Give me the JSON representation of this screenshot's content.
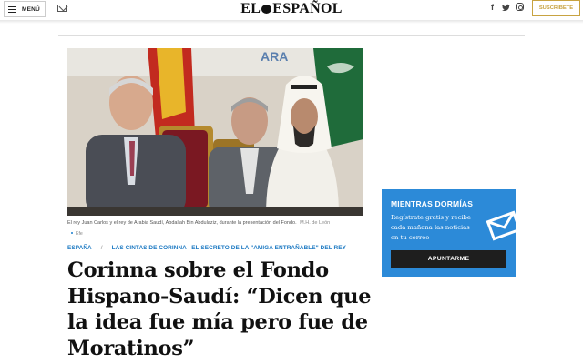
{
  "header": {
    "menu_label": "MENÚ",
    "logo_left": "EL",
    "logo_right": "ESPAÑOL",
    "subscribe_label": "SUSCRÍBETE",
    "social": [
      "f",
      "twitter",
      "instagram"
    ]
  },
  "photo": {
    "sign_text": "ARA",
    "caption": "El rey Juan Carlos y el rey de Arabia Saudí, Abdallah Bin Abdulaziz, durante la presentación del Fondo.",
    "credit": "M.H. de León",
    "source": "Efe"
  },
  "article": {
    "section": "ESPAÑA",
    "tag": "LAS CINTAS DE CORINNA | EL SECRETO DE LA \"AMIGA ENTRAÑABLE\" DEL REY",
    "headline": "Corinna sobre el Fondo Hispano-Saudí: “Dicen que la idea fue mía pero fue de Moratinos”"
  },
  "newsletter": {
    "title": "MIENTRAS DORMÍAS",
    "text": "Regístrate gratis y recibe cada mañana las noticias en tu correo",
    "button_label": "APUNTARME"
  },
  "colors": {
    "accent_blue": "#2c8ad8",
    "link_blue": "#1a78c2",
    "subscribe_gold": "#c8a341"
  },
  "icons": [
    "menu-icon",
    "mail-icon",
    "facebook-icon",
    "twitter-icon",
    "instagram-icon",
    "envelope-icon"
  ]
}
